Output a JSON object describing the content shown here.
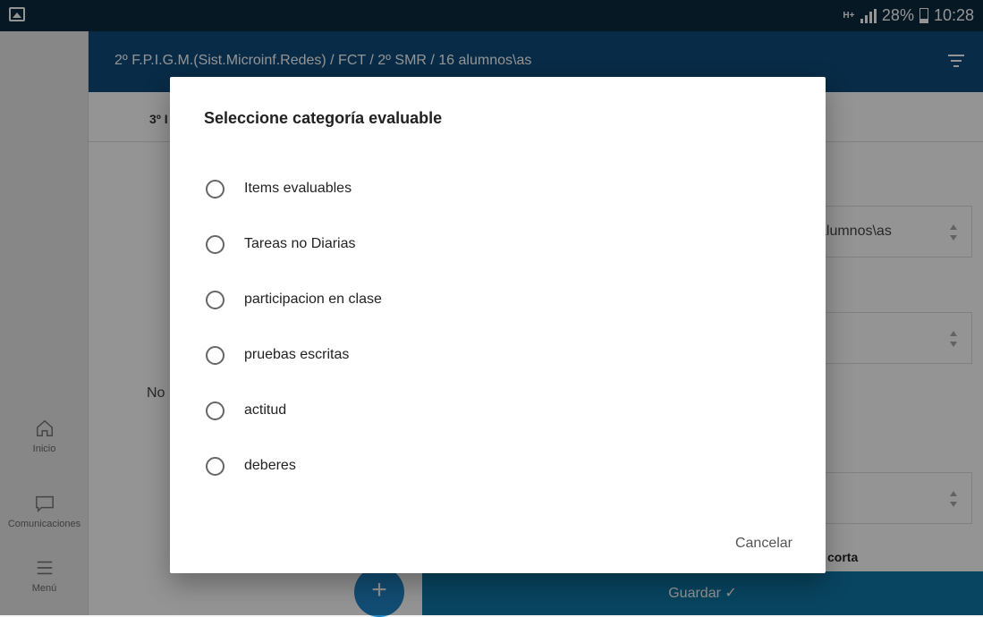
{
  "status": {
    "net": "H+",
    "battery": "28%",
    "time": "10:28"
  },
  "sidebar": {
    "items": [
      {
        "label": "Inicio",
        "icon": "home-icon"
      },
      {
        "label": "Comunicaciones",
        "icon": "chat-icon"
      },
      {
        "label": "Menú",
        "icon": "menu-icon"
      }
    ]
  },
  "header": {
    "title": "2º F.P.I.G.M.(Sist.Microinf.Redes) / FCT / 2º SMR / 16 alumnos\\as",
    "filter_icon": "filter-icon"
  },
  "tabbar": {
    "tab_label": "3º I"
  },
  "background": {
    "empty_text": "No",
    "field1_value": "alumnos\\as",
    "field2_value": "",
    "field3_value": "",
    "corta_label": "corta",
    "fab_label": "+",
    "save_label": "Guardar ✓"
  },
  "dialog": {
    "title": "Seleccione categoría evaluable",
    "options": [
      "Items evaluables",
      "Tareas no Diarias",
      "participacion en clase",
      "pruebas escritas",
      "actitud",
      "deberes"
    ],
    "cancel_label": "Cancelar"
  },
  "colors": {
    "header": "#0e4a7a",
    "status_bar": "#0d2a40",
    "save_bar": "#0f78a6",
    "fab": "#1f86c8"
  }
}
